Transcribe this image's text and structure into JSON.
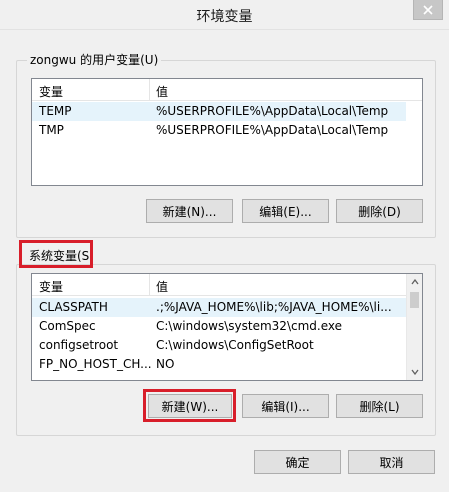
{
  "window": {
    "title": "环境变量",
    "close_icon": "close-icon"
  },
  "user_vars": {
    "group_label": "zongwu 的用户变量(U)",
    "col_variable": "变量",
    "col_value": "值",
    "rows": [
      {
        "name": "TEMP",
        "value": "%USERPROFILE%\\AppData\\Local\\Temp"
      },
      {
        "name": "TMP",
        "value": "%USERPROFILE%\\AppData\\Local\\Temp"
      }
    ],
    "new_label": "新建(N)...",
    "edit_label": "编辑(E)...",
    "delete_label": "删除(D)"
  },
  "system_vars": {
    "group_label": "系统变量(S)",
    "col_variable": "变量",
    "col_value": "值",
    "rows": [
      {
        "name": "CLASSPATH",
        "value": ".;%JAVA_HOME%\\lib;%JAVA_HOME%\\li..."
      },
      {
        "name": "ComSpec",
        "value": "C:\\windows\\system32\\cmd.exe"
      },
      {
        "name": "configsetroot",
        "value": "C:\\windows\\ConfigSetRoot"
      },
      {
        "name": "FP_NO_HOST_CH...",
        "value": "NO"
      }
    ],
    "new_label": "新建(W)...",
    "edit_label": "编辑(I)...",
    "delete_label": "删除(L)"
  },
  "footer": {
    "ok_label": "确定",
    "cancel_label": "取消"
  },
  "colors": {
    "highlight_red": "#d81e2a",
    "selected_row": "#e5f3fb"
  }
}
